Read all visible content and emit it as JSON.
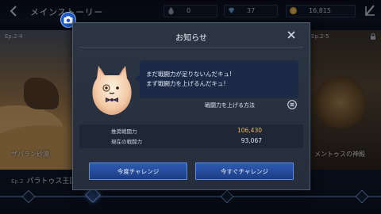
{
  "header": {
    "title": "メインストーリー",
    "resources": [
      {
        "icon": "droplet-icon",
        "value": "0"
      },
      {
        "icon": "diamond-icon",
        "value": "37"
      },
      {
        "icon": "gold-coin-icon",
        "value": "16,815"
      }
    ]
  },
  "background": {
    "left_card": {
      "tag": "Ep.2-4",
      "name": "ザパラン砂漠"
    },
    "right_card": {
      "tag": "Ep.2-5",
      "name": "メントゥスの神殿"
    },
    "center_tag": "Ep.2-",
    "episode_label": "Ep.2",
    "episode_name": "パラトゥス王国"
  },
  "dialog": {
    "title": "お知らせ",
    "message_line1": "まだ戦闘力が足りないんだキュ!",
    "message_line2": "まず戦闘力を上げるんだキュ!",
    "howto_label": "戦闘力を上げる方法",
    "recommended_label": "推奨戦闘力",
    "recommended_value": "106,430",
    "current_label": "現在の戦闘力",
    "current_value": "93,067",
    "later_button": "今度チャレンジ",
    "now_button": "今すぐチャレンジ"
  },
  "colors": {
    "accent_blue": "#2f5bb4",
    "recommended_orange": "#f0b85a",
    "dialog_bg": "#2c3544"
  }
}
